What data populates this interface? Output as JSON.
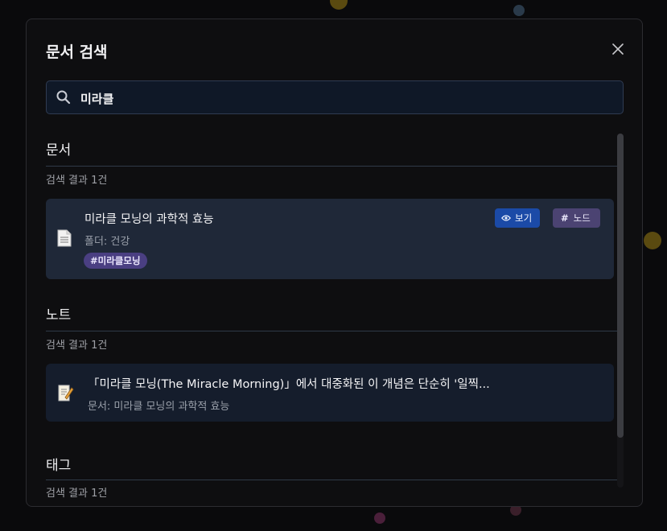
{
  "modal": {
    "title": "문서 검색",
    "close_label": "×"
  },
  "search": {
    "value": "미라클",
    "placeholder": ""
  },
  "sections": {
    "documents": {
      "title": "문서",
      "count": "검색 결과 1건",
      "item": {
        "title": "미라클 모닝의 과학적 효능",
        "folder": "폴더: 건강",
        "tag": "#미라클모닝",
        "view_label": "보기",
        "note_label": "노드",
        "note_icon": "#"
      }
    },
    "notes": {
      "title": "노트",
      "count": "검색 결과 1건",
      "item": {
        "text": "「미라클 모닝(The Miracle Morning)」에서 대중화된 이 개념은 단순히 '일찍...",
        "source": "문서: 미라클 모닝의 과학적 효능"
      }
    },
    "tags": {
      "title": "태그",
      "count": "검색 결과 1건"
    }
  },
  "colors": {
    "accent_blue": "#1b4aa7",
    "accent_purple": "#4b4372",
    "tag_purple": "#4a3f82"
  },
  "icons": {
    "search": "search-icon",
    "close": "close-icon",
    "document": "document-icon",
    "note": "memo-icon",
    "eye": "eye-icon"
  }
}
